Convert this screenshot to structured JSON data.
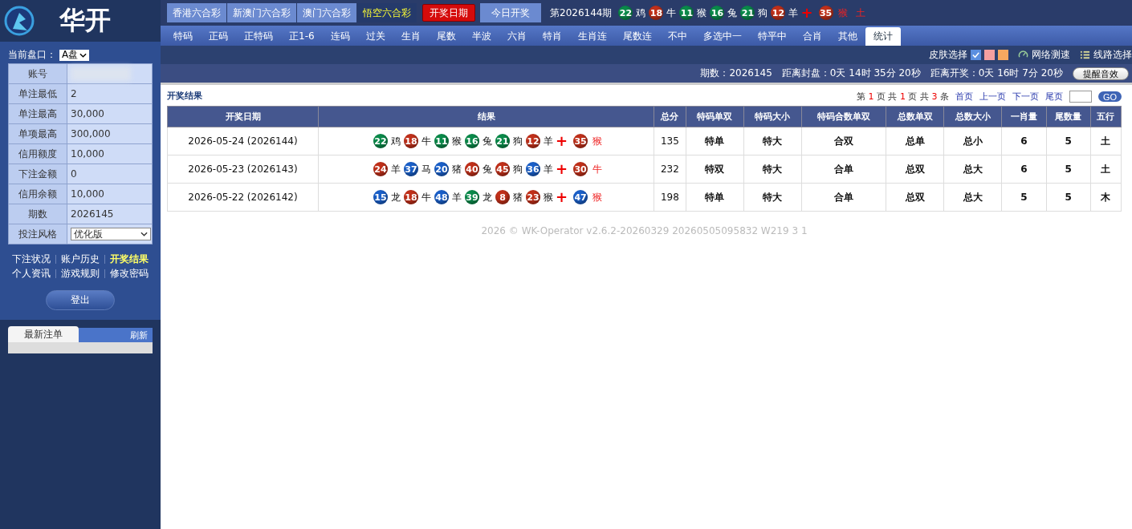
{
  "brand": {
    "title": "华开"
  },
  "lottery_tabs": [
    {
      "label": "香港六合彩",
      "selected": false
    },
    {
      "label": "新澳门六合彩",
      "selected": false
    },
    {
      "label": "澳门六合彩",
      "selected": false
    },
    {
      "label": "悟空六合彩",
      "selected": true
    }
  ],
  "draw_date_button": "开奖日期",
  "today_button": "今日开奖",
  "latest_draw": {
    "period": "第2026144期",
    "balls": [
      {
        "number": "22",
        "color": "#0a8a4a",
        "zodiac": "鸡"
      },
      {
        "number": "18",
        "color": "#c0301a",
        "zodiac": "牛"
      },
      {
        "number": "11",
        "color": "#0a8a4a",
        "zodiac": "猴"
      },
      {
        "number": "16",
        "color": "#0a8a4a",
        "zodiac": "兔"
      },
      {
        "number": "21",
        "color": "#0a8a4a",
        "zodiac": "狗"
      },
      {
        "number": "12",
        "color": "#c0301a",
        "zodiac": "羊"
      }
    ],
    "plus": "+",
    "special": {
      "number": "35",
      "color": "#c0301a",
      "zodiac": "猴"
    },
    "element": "土"
  },
  "nav_tabs": [
    {
      "label": "特码",
      "selected": false
    },
    {
      "label": "正码",
      "selected": false
    },
    {
      "label": "正特码",
      "selected": false
    },
    {
      "label": "正1-6",
      "selected": false
    },
    {
      "label": "连码",
      "selected": false
    },
    {
      "label": "过关",
      "selected": false
    },
    {
      "label": "生肖",
      "selected": false
    },
    {
      "label": "尾数",
      "selected": false
    },
    {
      "label": "半波",
      "selected": false
    },
    {
      "label": "六肖",
      "selected": false
    },
    {
      "label": "特肖",
      "selected": false
    },
    {
      "label": "生肖连",
      "selected": false
    },
    {
      "label": "尾数连",
      "selected": false
    },
    {
      "label": "不中",
      "selected": false
    },
    {
      "label": "多选中一",
      "selected": false
    },
    {
      "label": "特平中",
      "selected": false
    },
    {
      "label": "合肖",
      "selected": false
    },
    {
      "label": "其他",
      "selected": false
    },
    {
      "label": "统计",
      "selected": true
    }
  ],
  "toolbar": {
    "skin_label": "皮肤选择",
    "skins": [
      {
        "color": "#5b8fe0",
        "selected": true
      },
      {
        "color": "#f4a0a0",
        "selected": false
      },
      {
        "color": "#f5a860",
        "selected": false
      }
    ],
    "speed_test": "网络测速",
    "line_select": "线路选择"
  },
  "info_bar": {
    "period": "期数：2026145",
    "close_countdown": "距离封盘：0天 14时 35分 20秒",
    "draw_countdown": "距离开奖：0天 16时 7分 20秒",
    "sound_button": "提醒音效"
  },
  "sidebar": {
    "market_label": "当前盘口：",
    "market_value": "A盘",
    "account_rows": [
      {
        "label": "账号",
        "kind": "blurred"
      },
      {
        "label": "单注最低",
        "value": "2",
        "kind": "text"
      },
      {
        "label": "单注最高",
        "value": "30,000",
        "kind": "text"
      },
      {
        "label": "单项最高",
        "value": "300,000",
        "kind": "text"
      },
      {
        "label": "信用额度",
        "value": "10,000",
        "kind": "text"
      },
      {
        "label": "下注金额",
        "value": "0",
        "kind": "text"
      },
      {
        "label": "信用余额",
        "value": "10,000",
        "kind": "text"
      },
      {
        "label": "期数",
        "value": "2026145",
        "kind": "text"
      },
      {
        "label": "投注风格",
        "value": "优化版",
        "kind": "select"
      }
    ],
    "links": [
      {
        "label": "下注状况",
        "selected": false
      },
      {
        "label": "账户历史",
        "selected": false
      },
      {
        "label": "开奖结果",
        "selected": true
      },
      {
        "label": "个人资讯",
        "selected": false
      },
      {
        "label": "游戏规则",
        "selected": false
      },
      {
        "label": "修改密码",
        "selected": false
      }
    ],
    "logout": "登出",
    "latest_bets_tab": "最新注单",
    "refresh": "刷新"
  },
  "results": {
    "title": "开奖结果",
    "pager": {
      "prefix": "第",
      "page": "1",
      "mid1": "页 共",
      "pages": "1",
      "mid2": "页 共",
      "count": "3",
      "suffix": "条",
      "first": "首页",
      "prev": "上一页",
      "next": "下一页",
      "last": "尾页",
      "go": "GO"
    },
    "columns": [
      "开奖日期",
      "结果",
      "总分",
      "特码单双",
      "特码大小",
      "特码合数单双",
      "总数单双",
      "总数大小",
      "一肖量",
      "尾数量",
      "五行"
    ],
    "rows": [
      {
        "cells": [
          {
            "kind": "text",
            "text": "2026-05-24 (2026144)"
          },
          {
            "kind": "draw",
            "balls": [
              {
                "number": "22",
                "color": "#0a8a4a",
                "zodiac": "鸡"
              },
              {
                "number": "18",
                "color": "#c0301a",
                "zodiac": "牛"
              },
              {
                "number": "11",
                "color": "#0a8a4a",
                "zodiac": "猴"
              },
              {
                "number": "16",
                "color": "#0a8a4a",
                "zodiac": "兔"
              },
              {
                "number": "21",
                "color": "#0a8a4a",
                "zodiac": "狗"
              },
              {
                "number": "12",
                "color": "#c0301a",
                "zodiac": "羊"
              }
            ],
            "special": {
              "number": "35",
              "color": "#c0301a",
              "zodiac": "猴"
            }
          },
          {
            "kind": "text",
            "text": "135"
          },
          {
            "kind": "bold",
            "text": "特单"
          },
          {
            "kind": "bold",
            "text": "特大"
          },
          {
            "kind": "bold",
            "text": "合双"
          },
          {
            "kind": "bold",
            "text": "总单"
          },
          {
            "kind": "bold",
            "text": "总小"
          },
          {
            "kind": "bold",
            "text": "6"
          },
          {
            "kind": "bold",
            "text": "5"
          },
          {
            "kind": "bold",
            "text": "土"
          }
        ]
      },
      {
        "cells": [
          {
            "kind": "text",
            "text": "2026-05-23 (2026143)"
          },
          {
            "kind": "draw",
            "balls": [
              {
                "number": "24",
                "color": "#c0301a",
                "zodiac": "羊"
              },
              {
                "number": "37",
                "color": "#1a5fc8",
                "zodiac": "马"
              },
              {
                "number": "20",
                "color": "#1a5fc8",
                "zodiac": "猪"
              },
              {
                "number": "40",
                "color": "#c0301a",
                "zodiac": "兔"
              },
              {
                "number": "45",
                "color": "#c0301a",
                "zodiac": "狗"
              },
              {
                "number": "36",
                "color": "#1a5fc8",
                "zodiac": "羊"
              }
            ],
            "special": {
              "number": "30",
              "color": "#c0301a",
              "zodiac": "牛"
            }
          },
          {
            "kind": "text",
            "text": "232"
          },
          {
            "kind": "bold",
            "text": "特双"
          },
          {
            "kind": "bold",
            "text": "特大"
          },
          {
            "kind": "bold",
            "text": "合单"
          },
          {
            "kind": "bold",
            "text": "总双"
          },
          {
            "kind": "bold",
            "text": "总大"
          },
          {
            "kind": "bold",
            "text": "6"
          },
          {
            "kind": "bold",
            "text": "5"
          },
          {
            "kind": "bold",
            "text": "土"
          }
        ]
      },
      {
        "cells": [
          {
            "kind": "text",
            "text": "2026-05-22 (2026142)"
          },
          {
            "kind": "draw",
            "balls": [
              {
                "number": "15",
                "color": "#1a5fc8",
                "zodiac": "龙"
              },
              {
                "number": "18",
                "color": "#c0301a",
                "zodiac": "牛"
              },
              {
                "number": "48",
                "color": "#1a5fc8",
                "zodiac": "羊"
              },
              {
                "number": "39",
                "color": "#0a8a4a",
                "zodiac": "龙"
              },
              {
                "number": "8",
                "color": "#c0301a",
                "zodiac": "猪"
              },
              {
                "number": "23",
                "color": "#c0301a",
                "zodiac": "猴"
              }
            ],
            "special": {
              "number": "47",
              "color": "#1a5fc8",
              "zodiac": "猴"
            }
          },
          {
            "kind": "text",
            "text": "198"
          },
          {
            "kind": "bold",
            "text": "特单"
          },
          {
            "kind": "bold",
            "text": "特大"
          },
          {
            "kind": "bold",
            "text": "合单"
          },
          {
            "kind": "bold",
            "text": "总双"
          },
          {
            "kind": "bold",
            "text": "总大"
          },
          {
            "kind": "bold",
            "text": "5"
          },
          {
            "kind": "bold",
            "text": "5"
          },
          {
            "kind": "bold",
            "text": "木"
          }
        ]
      }
    ],
    "plus": "+"
  },
  "footer": "2026 © WK-Operator v2.6.2-20260329 20260505095832 W219 3 1"
}
